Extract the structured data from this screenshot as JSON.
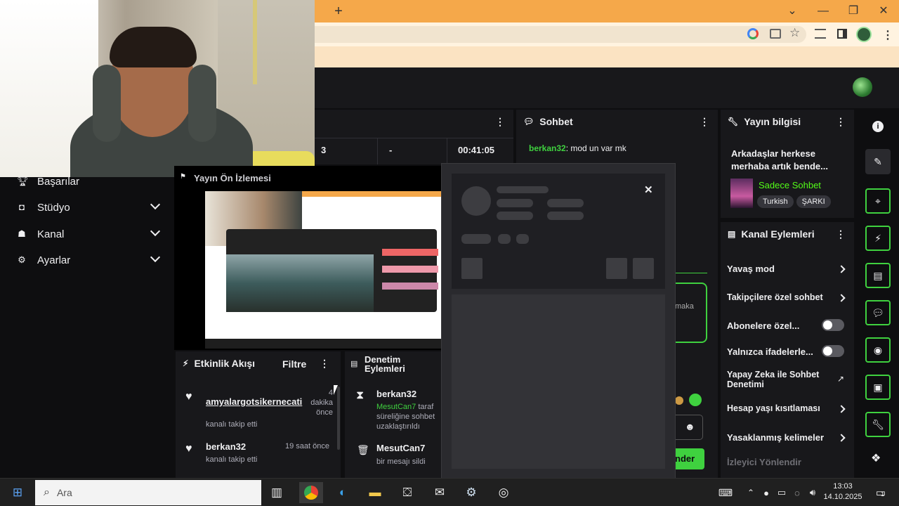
{
  "browser": {
    "new_tab_symbol": "+",
    "window_controls": [
      "⌄",
      "—",
      "❐",
      "✕"
    ]
  },
  "webcam": {
    "description": ""
  },
  "sidebar": {
    "items": [
      {
        "label": "Başarılar",
        "icon": "trophy-icon"
      },
      {
        "label": "Stüdyo",
        "icon": "studio-icon"
      },
      {
        "label": "Kanal",
        "icon": "channel-icon"
      },
      {
        "label": "Ayarlar",
        "icon": "gear-icon"
      }
    ]
  },
  "stats": {
    "cells": [
      "3",
      "-",
      "00:41:05"
    ]
  },
  "preview": {
    "title": "Yayın Ön İzlemesi"
  },
  "chat": {
    "title": "Sohbet",
    "messages": [
      {
        "user": "berkan32",
        "text": "mod un var mk"
      }
    ],
    "send_label": "nder",
    "partial_text": "maka"
  },
  "stream_info": {
    "title": "Yayın bilgisi",
    "stream_title": "Arkadaşlar herkese merhaba artık bende...",
    "category": "Sadece Sohbet",
    "tags": [
      "Turkish",
      "ŞARKI"
    ]
  },
  "channel_actions": {
    "title": "Kanal Eylemleri",
    "items": [
      {
        "label": "Yavaş mod",
        "control": "arrow"
      },
      {
        "label": "Takipçilere özel sohbet",
        "control": "arrow"
      },
      {
        "label": "Abonelere özel...",
        "control": "toggle"
      },
      {
        "label": "Yalnızca ifadelerle...",
        "control": "toggle"
      },
      {
        "label": "Yapay Zeka ile Sohbet Denetimi",
        "control": "external"
      },
      {
        "label": "Hesap yaşı kısıtlaması",
        "control": "arrow"
      },
      {
        "label": "Yasaklanmış kelimeler",
        "control": "arrow"
      },
      {
        "label": "İzleyici Yönlendir",
        "control": "none"
      }
    ]
  },
  "activity": {
    "title": "Etkinlik Akışı",
    "filter_label": "Filtre",
    "events": [
      {
        "user": "amyalargotsikernecati",
        "action": "kanalı takip etti",
        "time": "4 dakika önce"
      },
      {
        "user": "berkan32",
        "action": "kanalı takip etti",
        "time": "19 saat önce"
      }
    ]
  },
  "mod_actions": {
    "title": "Denetim Eylemleri",
    "events": [
      {
        "user": "berkan32",
        "target": "MesutCan7",
        "text": "taraf süreliğine sohbet uzaklaştırıldı"
      },
      {
        "user": "MesutCan7",
        "text": "bir mesajı sildi"
      }
    ]
  },
  "overlay": {
    "close_symbol": "✕"
  },
  "taskbar": {
    "search_placeholder": "Ara",
    "time": "13:03",
    "date": "14.10.2025",
    "notification_count": "1"
  },
  "colors": {
    "accent": "#3fd13f",
    "category": "#53fc18"
  }
}
